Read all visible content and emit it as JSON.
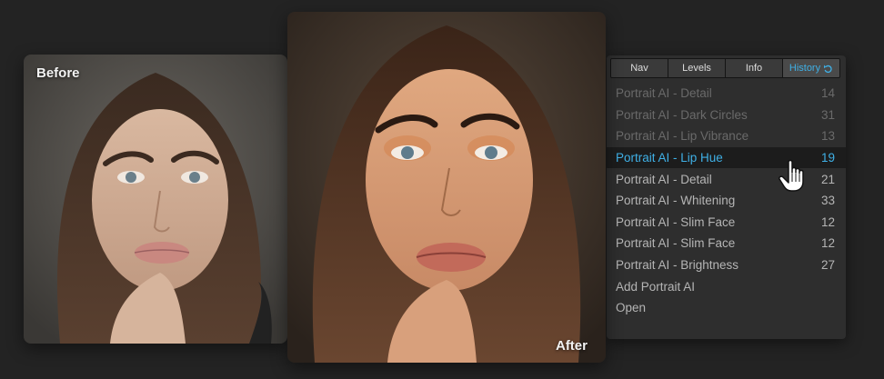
{
  "before": {
    "label": "Before"
  },
  "after": {
    "label": "After"
  },
  "tabs": [
    {
      "label": "Nav",
      "active": false
    },
    {
      "label": "Levels",
      "active": false
    },
    {
      "label": "Info",
      "active": false
    },
    {
      "label": "History",
      "active": true
    }
  ],
  "history": [
    {
      "label": "Portrait AI - Detail",
      "count": "14",
      "state": "dim"
    },
    {
      "label": "Portrait AI - Dark Circles",
      "count": "31",
      "state": "dim"
    },
    {
      "label": "Portrait AI - Lip Vibrance",
      "count": "13",
      "state": "dim"
    },
    {
      "label": "Portrait AI - Lip Hue",
      "count": "19",
      "state": "selected"
    },
    {
      "label": "Portrait AI - Detail",
      "count": "21",
      "state": "normal"
    },
    {
      "label": "Portrait AI - Whitening",
      "count": "33",
      "state": "normal"
    },
    {
      "label": "Portrait AI - Slim Face",
      "count": "12",
      "state": "normal"
    },
    {
      "label": "Portrait AI - Slim Face",
      "count": "12",
      "state": "normal"
    },
    {
      "label": "Portrait AI - Brightness",
      "count": "27",
      "state": "normal"
    },
    {
      "label": "Add Portrait AI",
      "count": "",
      "state": "normal"
    },
    {
      "label": "Open",
      "count": "",
      "state": "normal"
    }
  ],
  "colors": {
    "background": "#232323",
    "panel": "#2e2e2e",
    "accent": "#3fb0e6",
    "selected_row": "#1c1c1c"
  },
  "icons": {
    "history_tab": "undo-icon",
    "cursor": "hand-pointer-icon"
  }
}
